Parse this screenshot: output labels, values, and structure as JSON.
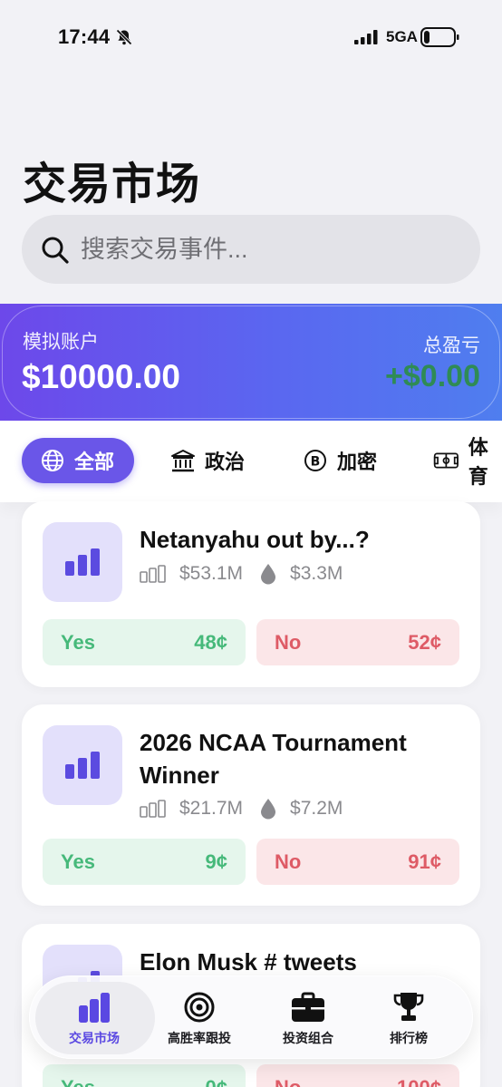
{
  "status_bar": {
    "time": "17:44",
    "network": "5GA"
  },
  "header": {
    "title": "交易市场"
  },
  "search": {
    "placeholder": "搜索交易事件..."
  },
  "account": {
    "label": "模拟账户",
    "balance": "$10000.00",
    "pnl_label": "总盈亏",
    "pnl_value": "+$0.00"
  },
  "categories": [
    {
      "label": "全部",
      "icon": "globe-icon",
      "active": true
    },
    {
      "label": "政治",
      "icon": "government-icon"
    },
    {
      "label": "加密",
      "icon": "bitcoin-icon"
    },
    {
      "label": "体育",
      "icon": "soccer-field-icon"
    }
  ],
  "markets": [
    {
      "title": "Netanyahu out by...?",
      "volume": "$53.1M",
      "liquidity": "$3.3M",
      "yes_label": "Yes",
      "yes_price": "48¢",
      "no_label": "No",
      "no_price": "52¢"
    },
    {
      "title": "2026 NCAA Tournament Winner",
      "volume": "$21.7M",
      "liquidity": "$7.2M",
      "yes_label": "Yes",
      "yes_price": "9¢",
      "no_label": "No",
      "no_price": "91¢"
    },
    {
      "title": "Elon Musk # tweets",
      "volume": "",
      "liquidity": "",
      "yes_label": "Yes",
      "yes_price": "0¢",
      "no_label": "No",
      "no_price": "100¢"
    }
  ],
  "nav": [
    {
      "label": "交易市场",
      "icon": "bar-chart-icon",
      "active": true
    },
    {
      "label": "高胜率跟投",
      "icon": "target-icon"
    },
    {
      "label": "投资组合",
      "icon": "briefcase-icon"
    },
    {
      "label": "排行榜",
      "icon": "trophy-icon"
    }
  ],
  "colors": {
    "accent": "#6a56e8",
    "banner_start": "#6d48ea",
    "banner_end": "#4f7eef",
    "pnl": "#2f8b55",
    "yes_text": "#46b97a",
    "no_text": "#de5b66"
  }
}
